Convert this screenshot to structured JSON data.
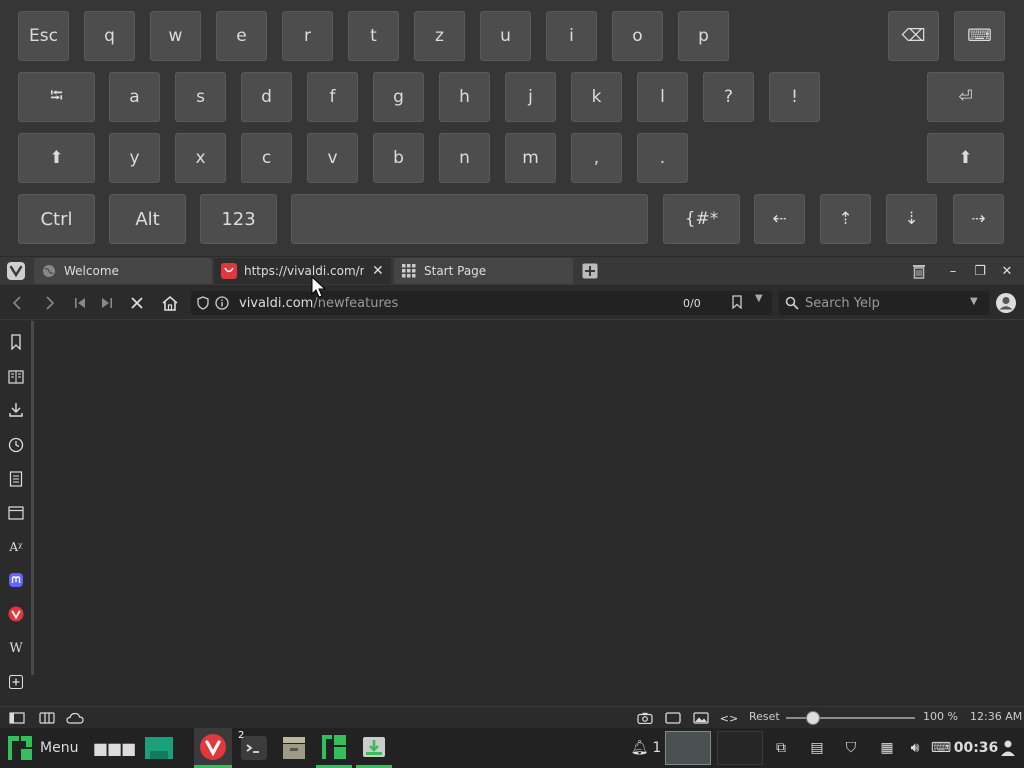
{
  "keyboard": {
    "row1": [
      "Esc",
      "q",
      "w",
      "e",
      "r",
      "t",
      "z",
      "u",
      "i",
      "o",
      "p"
    ],
    "backspace_glyph": "⌫",
    "keyboard_glyph": "⌨",
    "row2": [
      "⭾",
      "a",
      "s",
      "d",
      "f",
      "g",
      "h",
      "j",
      "k",
      "l",
      "?",
      "!"
    ],
    "enter_glyph": "⏎",
    "row3": [
      "⬆",
      "y",
      "x",
      "c",
      "v",
      "b",
      "n",
      "m",
      ",",
      "."
    ],
    "shift_right_glyph": "⬆",
    "row4": [
      "Ctrl",
      "Alt",
      "123",
      "",
      "{#*",
      "⇠",
      "⇡",
      "⇣",
      "⇢"
    ]
  },
  "tabs": [
    {
      "title": "Welcome"
    },
    {
      "title": "https://vivaldi.com/newfeatures"
    },
    {
      "title": "Start Page"
    }
  ],
  "address": {
    "url_host": "vivaldi.com",
    "url_path": "/newfeatures",
    "find_count": "0/0",
    "search_placeholder": "Search Yelp"
  },
  "statusbar": {
    "reset_label": "Reset",
    "zoom_level": "100 %",
    "time": "12:36 AM"
  },
  "taskbar": {
    "menu_label": "Menu",
    "workspace_number": "1",
    "terminal_badge": "2",
    "clock": "00:36"
  },
  "colors": {
    "vivaldi_red": "#e0383c",
    "manjaro_green": "#35bf5c",
    "active_tab": "#2e2e2e"
  }
}
